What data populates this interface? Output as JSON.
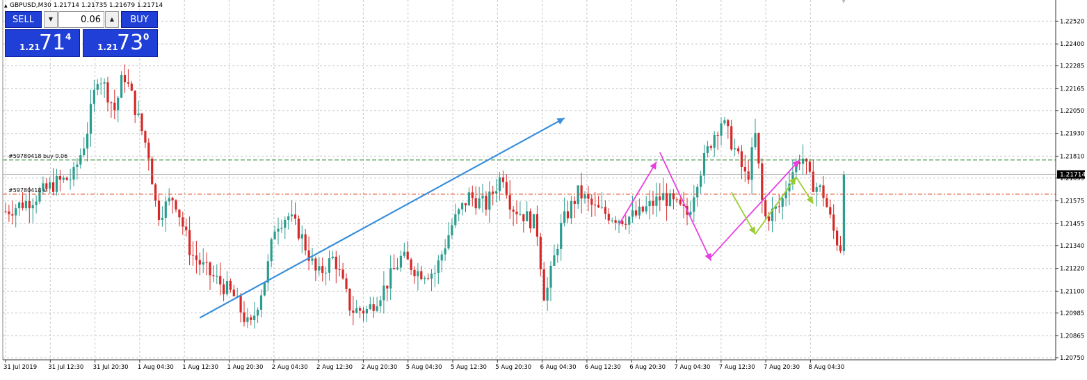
{
  "header": {
    "title": "GBPUSD,M30  1.21714 1.21735 1.21679 1.21714"
  },
  "trade_panel": {
    "sell_label": "SELL",
    "buy_label": "BUY",
    "lot_value": "0.06",
    "sell_price": {
      "prefix": "1.21",
      "big": "71",
      "sup": "4"
    },
    "buy_price": {
      "prefix": "1.21",
      "big": "73",
      "sup": "0"
    }
  },
  "order_lines": [
    {
      "label": "#59780418 buy 0.06",
      "price": 1.2179,
      "color": "#2e8b2e"
    },
    {
      "label": "#59780418 sl",
      "price": 1.2161,
      "color": "#e0502a"
    }
  ],
  "colors": {
    "bull": "#2a9d8f",
    "bear": "#d62828",
    "grid": "#c8c8c8",
    "blue_arrow": "#3a8fdc",
    "magenta_arrow": "#e83ee0",
    "green_arrow": "#9acd32",
    "current_price_bg": "#000000"
  },
  "chart_data": {
    "type": "candlestick",
    "symbol": "GBPUSD",
    "timeframe": "M30",
    "current_price": "1.21714",
    "ylim": [
      1.2075,
      1.2258
    ],
    "y_ticks": [
      "1.22520",
      "1.22400",
      "1.22285",
      "1.22165",
      "1.22050",
      "1.21930",
      "1.21810",
      "1.21695",
      "1.21575",
      "1.21455",
      "1.21340",
      "1.21220",
      "1.21100",
      "1.20985",
      "1.20865",
      "1.20750"
    ],
    "x_ticks": [
      "31 Jul 2019",
      "31 Jul 12:30",
      "31 Jul 20:30",
      "1 Aug 04:30",
      "1 Aug 12:30",
      "1 Aug 20:30",
      "2 Aug 04:30",
      "2 Aug 12:30",
      "2 Aug 20:30",
      "5 Aug 04:30",
      "5 Aug 12:30",
      "5 Aug 20:30",
      "6 Aug 04:30",
      "6 Aug 12:30",
      "6 Aug 20:30",
      "7 Aug 04:30",
      "7 Aug 12:30",
      "7 Aug 20:30",
      "8 Aug 04:30"
    ],
    "candle_count": 200,
    "keypoints": [
      [
        0,
        1.2152
      ],
      [
        6,
        1.2158
      ],
      [
        12,
        1.2167
      ],
      [
        16,
        1.217
      ],
      [
        19,
        1.219
      ],
      [
        22,
        1.2225
      ],
      [
        26,
        1.2205
      ],
      [
        28,
        1.2225
      ],
      [
        30,
        1.2212
      ],
      [
        34,
        1.2182
      ],
      [
        36,
        1.215
      ],
      [
        40,
        1.216
      ],
      [
        44,
        1.213
      ],
      [
        48,
        1.212
      ],
      [
        54,
        1.2108
      ],
      [
        58,
        1.209
      ],
      [
        62,
        1.212
      ],
      [
        64,
        1.2145
      ],
      [
        67,
        1.215
      ],
      [
        70,
        1.214
      ],
      [
        74,
        1.2118
      ],
      [
        78,
        1.2128
      ],
      [
        82,
        1.21
      ],
      [
        86,
        1.21
      ],
      [
        90,
        1.2112
      ],
      [
        94,
        1.2128
      ],
      [
        98,
        1.212
      ],
      [
        102,
        1.212
      ],
      [
        106,
        1.2145
      ],
      [
        110,
        1.216
      ],
      [
        114,
        1.2155
      ],
      [
        118,
        1.2172
      ],
      [
        120,
        1.2155
      ],
      [
        126,
        1.2145
      ],
      [
        128,
        1.2105
      ],
      [
        132,
        1.2145
      ],
      [
        136,
        1.2162
      ],
      [
        140,
        1.2153
      ],
      [
        146,
        1.2148
      ],
      [
        150,
        1.215
      ],
      [
        156,
        1.216
      ],
      [
        162,
        1.215
      ],
      [
        164,
        1.2168
      ],
      [
        168,
        1.2192
      ],
      [
        170,
        1.22
      ],
      [
        173,
        1.2185
      ],
      [
        176,
        1.2168
      ],
      [
        178,
        1.2192
      ],
      [
        180,
        1.2148
      ],
      [
        184,
        1.2155
      ],
      [
        186,
        1.217
      ],
      [
        189,
        1.2182
      ],
      [
        191,
        1.2168
      ],
      [
        194,
        1.2162
      ],
      [
        197,
        1.2138
      ],
      [
        199,
        1.213
      ]
    ],
    "arrows": [
      {
        "color": "blue",
        "from": [
          57,
          1.2096
        ],
        "to": [
          164,
          1.2201
        ]
      },
      {
        "color": "magenta",
        "from": [
          180,
          1.2145
        ],
        "to": [
          191,
          1.2178
        ]
      },
      {
        "color": "magenta",
        "from": [
          192,
          1.2183
        ],
        "to": [
          207,
          1.2126
        ]
      },
      {
        "color": "magenta",
        "from": [
          207,
          1.2128
        ],
        "to": [
          233,
          1.2179
        ]
      },
      {
        "color": "green",
        "from": [
          213,
          1.2162
        ],
        "to": [
          220,
          1.214
        ]
      },
      {
        "color": "green",
        "from": [
          220,
          1.214
        ],
        "to": [
          232,
          1.217
        ]
      },
      {
        "color": "green",
        "from": [
          232,
          1.217
        ],
        "to": [
          237,
          1.2156
        ]
      }
    ]
  }
}
